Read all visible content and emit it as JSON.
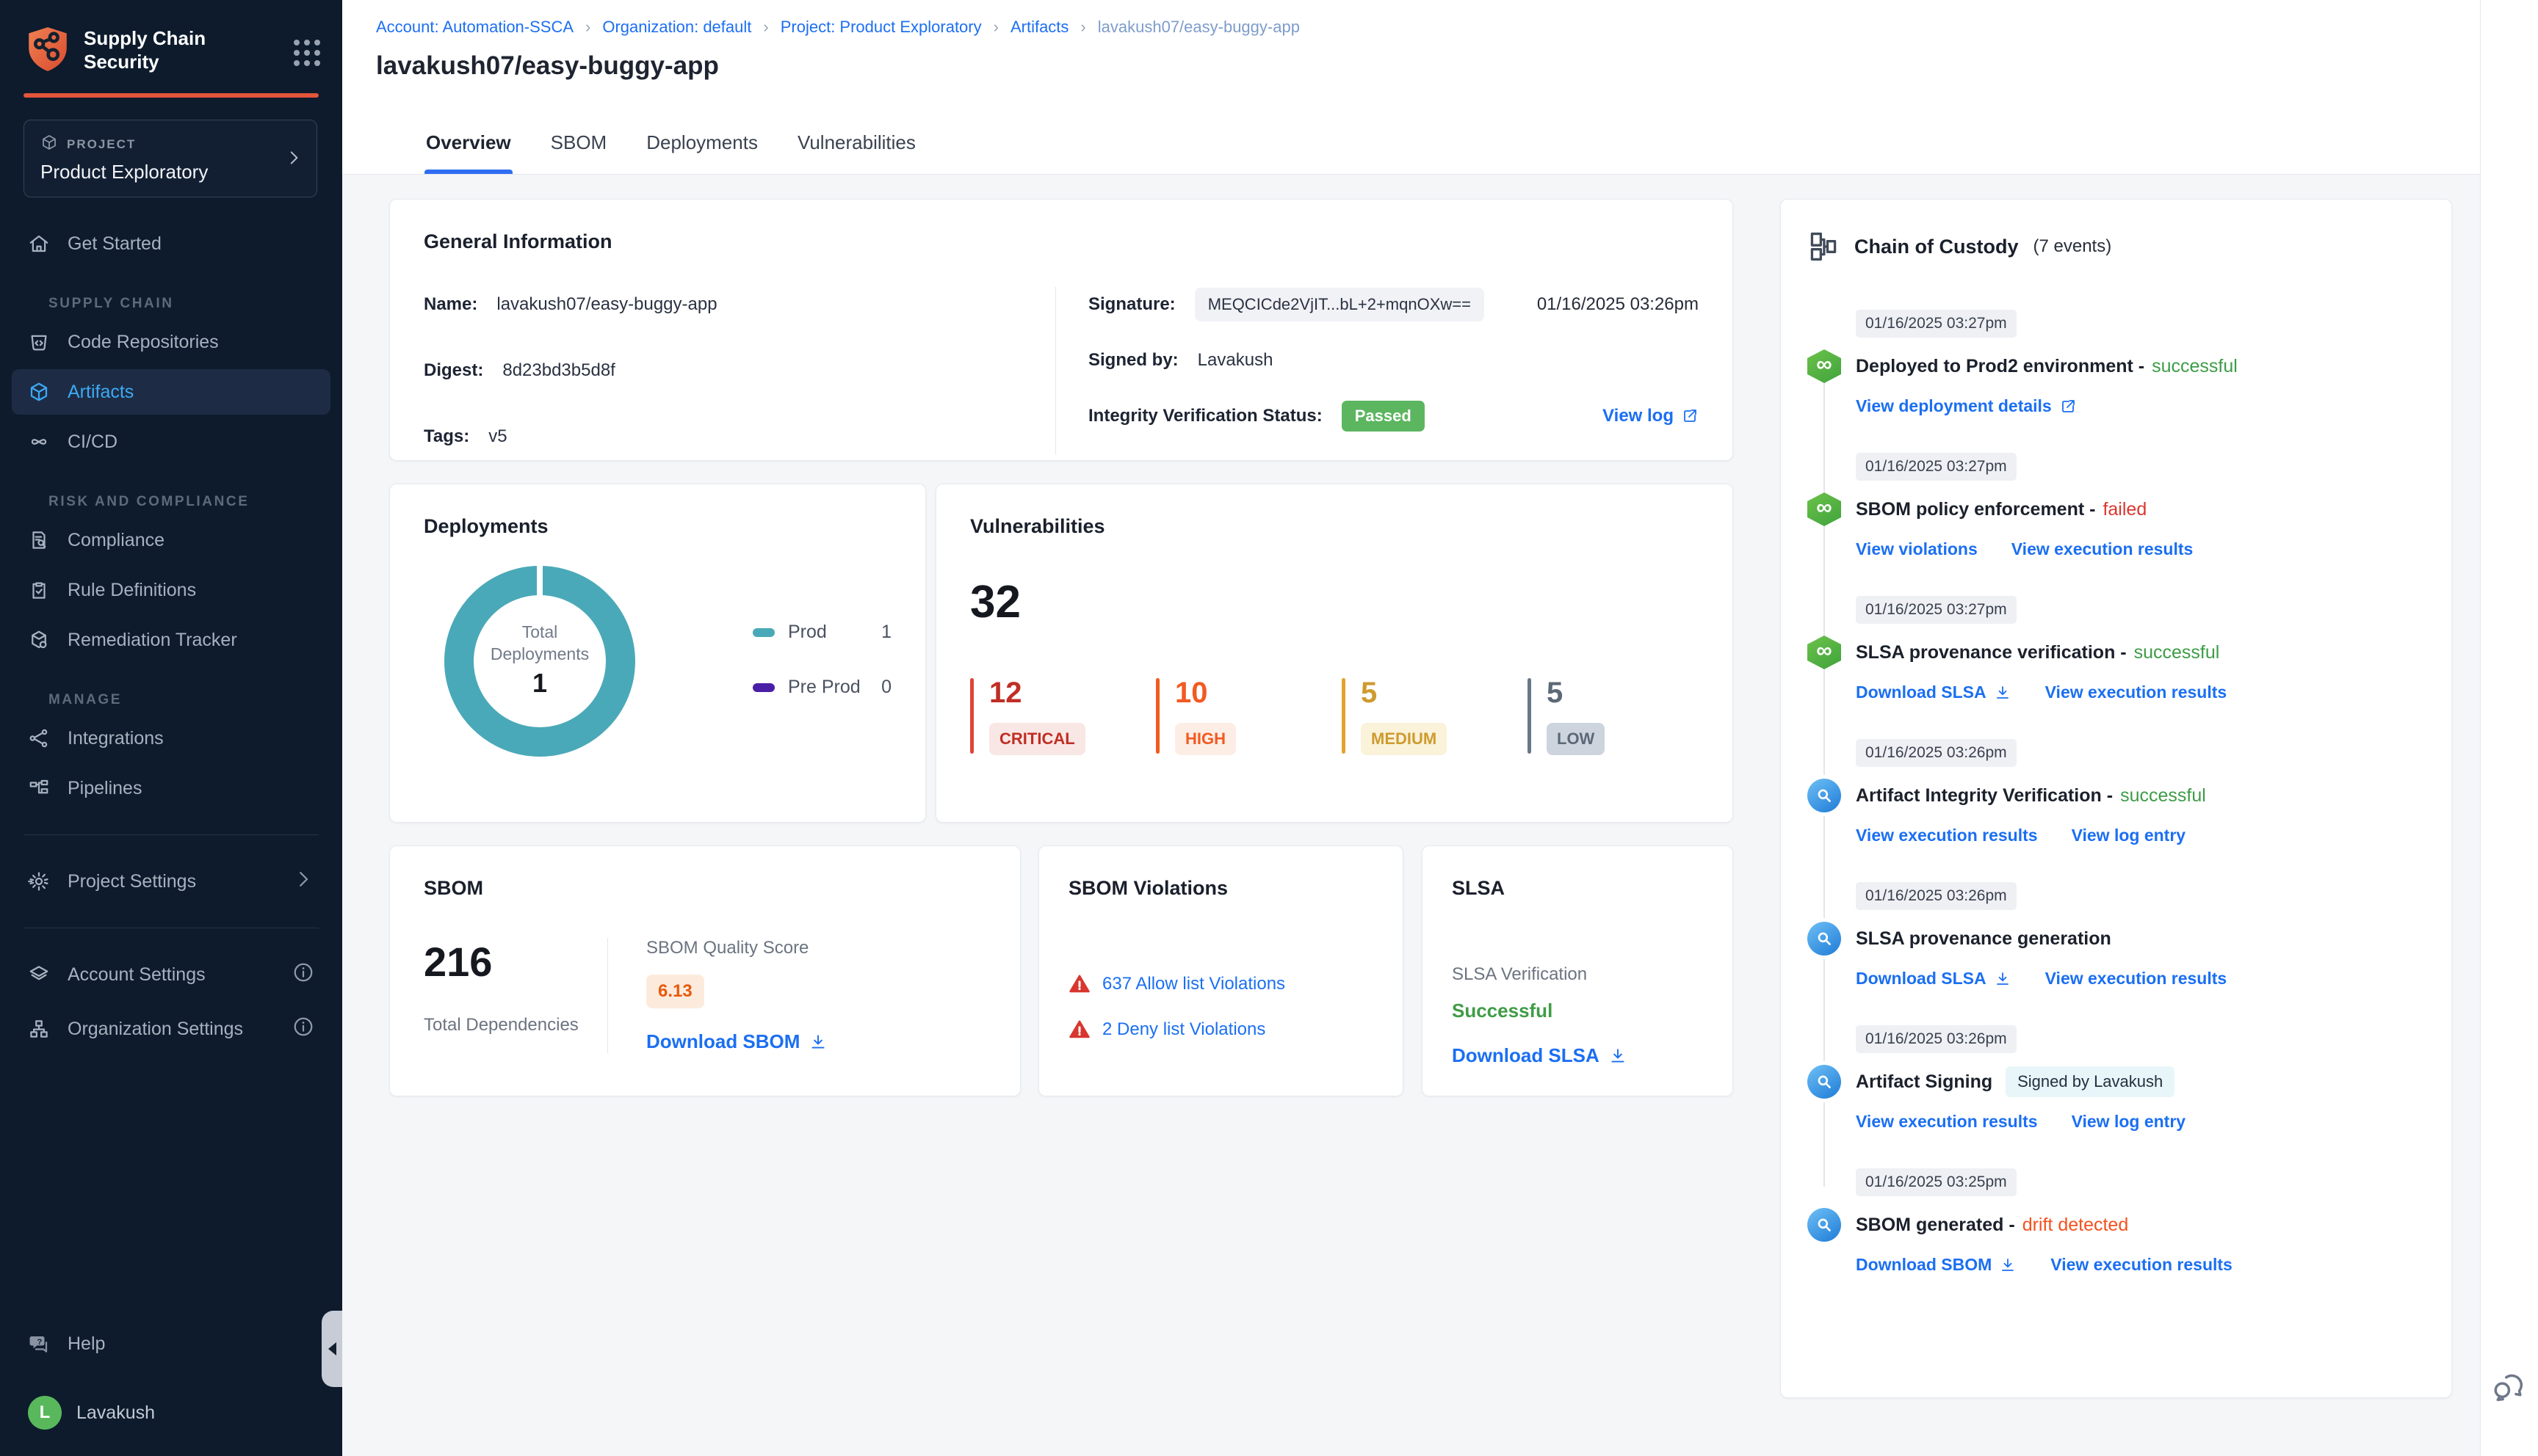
{
  "colors": {
    "accent_blue": "#1B6FF2",
    "sidebar_bg": "#0D1B2C",
    "brand_orange": "#E2543C",
    "success_green": "#3D9C47",
    "fail_red": "#D7372F",
    "drift_orange": "#F4511E",
    "teal": "#4AA9B8",
    "pre_prod_purple": "#4A1FA8",
    "passed_badge": "#5CB660",
    "quality_orange": "#E8590C"
  },
  "icons": {
    "infinity": "∞",
    "question": "?"
  },
  "sidebar": {
    "brand_line1": "Supply Chain",
    "brand_line2": "Security",
    "project_label": "PROJECT",
    "project_name": "Product Exploratory",
    "labels": {
      "supply_chain": "SUPPLY CHAIN",
      "risk": "RISK AND COMPLIANCE",
      "manage": "MANAGE"
    },
    "items": {
      "get_started": "Get Started",
      "code_repositories": "Code Repositories",
      "artifacts": "Artifacts",
      "cicd": "CI/CD",
      "compliance": "Compliance",
      "rule_definitions": "Rule Definitions",
      "remediation_tracker": "Remediation Tracker",
      "integrations": "Integrations",
      "pipelines": "Pipelines",
      "project_settings": "Project Settings",
      "account_settings": "Account Settings",
      "organization_settings": "Organization Settings",
      "help": "Help"
    },
    "user": {
      "initial": "L",
      "name": "Lavakush"
    }
  },
  "breadcrumb": {
    "separator": "›",
    "items": [
      "Account: Automation-SSCA",
      "Organization: default",
      "Project: Product Exploratory",
      "Artifacts",
      "lavakush07/easy-buggy-app"
    ]
  },
  "page_title": "lavakush07/easy-buggy-app",
  "tabs": [
    "Overview",
    "SBOM",
    "Deployments",
    "Vulnerabilities"
  ],
  "general": {
    "title": "General Information",
    "name_label": "Name:",
    "name": "lavakush07/easy-buggy-app",
    "digest_label": "Digest:",
    "digest": "8d23bd3b5d8f",
    "tags_label": "Tags:",
    "tags": "v5",
    "signature_label": "Signature:",
    "signature": "MEQCICde2VjIT...bL+2+mqnOXw==",
    "signature_date": "01/16/2025 03:26pm",
    "signed_by_label": "Signed by:",
    "signed_by": "Lavakush",
    "integrity_label": "Integrity Verification Status:",
    "integrity_status": "Passed",
    "view_log": "View log"
  },
  "deployments": {
    "title": "Deployments",
    "center_label": "Total Deployments",
    "total": "1",
    "legend": [
      {
        "label": "Prod",
        "value": "1"
      },
      {
        "label": "Pre Prod",
        "value": "0"
      }
    ]
  },
  "vulnerabilities": {
    "title": "Vulnerabilities",
    "total": "32",
    "severities": [
      {
        "count": "12",
        "label": "CRITICAL"
      },
      {
        "count": "10",
        "label": "HIGH"
      },
      {
        "count": "5",
        "label": "MEDIUM"
      },
      {
        "count": "5",
        "label": "LOW"
      }
    ]
  },
  "sbom": {
    "title": "SBOM",
    "total": "216",
    "total_label": "Total Dependencies",
    "quality_label": "SBOM Quality Score",
    "quality_score": "6.13",
    "download": "Download SBOM"
  },
  "violations": {
    "title": "SBOM Violations",
    "allow": "637 Allow list Violations",
    "deny": "2 Deny list Violations"
  },
  "slsa": {
    "title": "SLSA",
    "verification_label": "SLSA Verification",
    "status": "Successful",
    "download": "Download SLSA"
  },
  "chain": {
    "title": "Chain of Custody",
    "events_count": "(7 events)",
    "events": [
      {
        "ts": "01/16/2025 03:27pm",
        "title": "Deployed to Prod2 environment -",
        "status": "successful",
        "links": [
          "View deployment details"
        ]
      },
      {
        "ts": "01/16/2025 03:27pm",
        "title": "SBOM policy enforcement -",
        "status": "failed",
        "links": [
          "View violations",
          "View execution results"
        ]
      },
      {
        "ts": "01/16/2025 03:27pm",
        "title": "SLSA provenance verification -",
        "status": "successful",
        "links": [
          "Download SLSA",
          "View execution results"
        ]
      },
      {
        "ts": "01/16/2025 03:26pm",
        "title": "Artifact Integrity Verification -",
        "status": "successful",
        "links": [
          "View execution results",
          "View log entry"
        ]
      },
      {
        "ts": "01/16/2025 03:26pm",
        "title": "SLSA provenance generation",
        "status": "",
        "links": [
          "Download SLSA",
          "View execution results"
        ]
      },
      {
        "ts": "01/16/2025 03:26pm",
        "title": "Artifact Signing",
        "status": "",
        "badge": "Signed by Lavakush",
        "links": [
          "View execution results",
          "View log entry"
        ]
      },
      {
        "ts": "01/16/2025 03:25pm",
        "title": "SBOM generated -",
        "status": "drift detected",
        "links": [
          "Download SBOM",
          "View execution results"
        ]
      }
    ]
  }
}
